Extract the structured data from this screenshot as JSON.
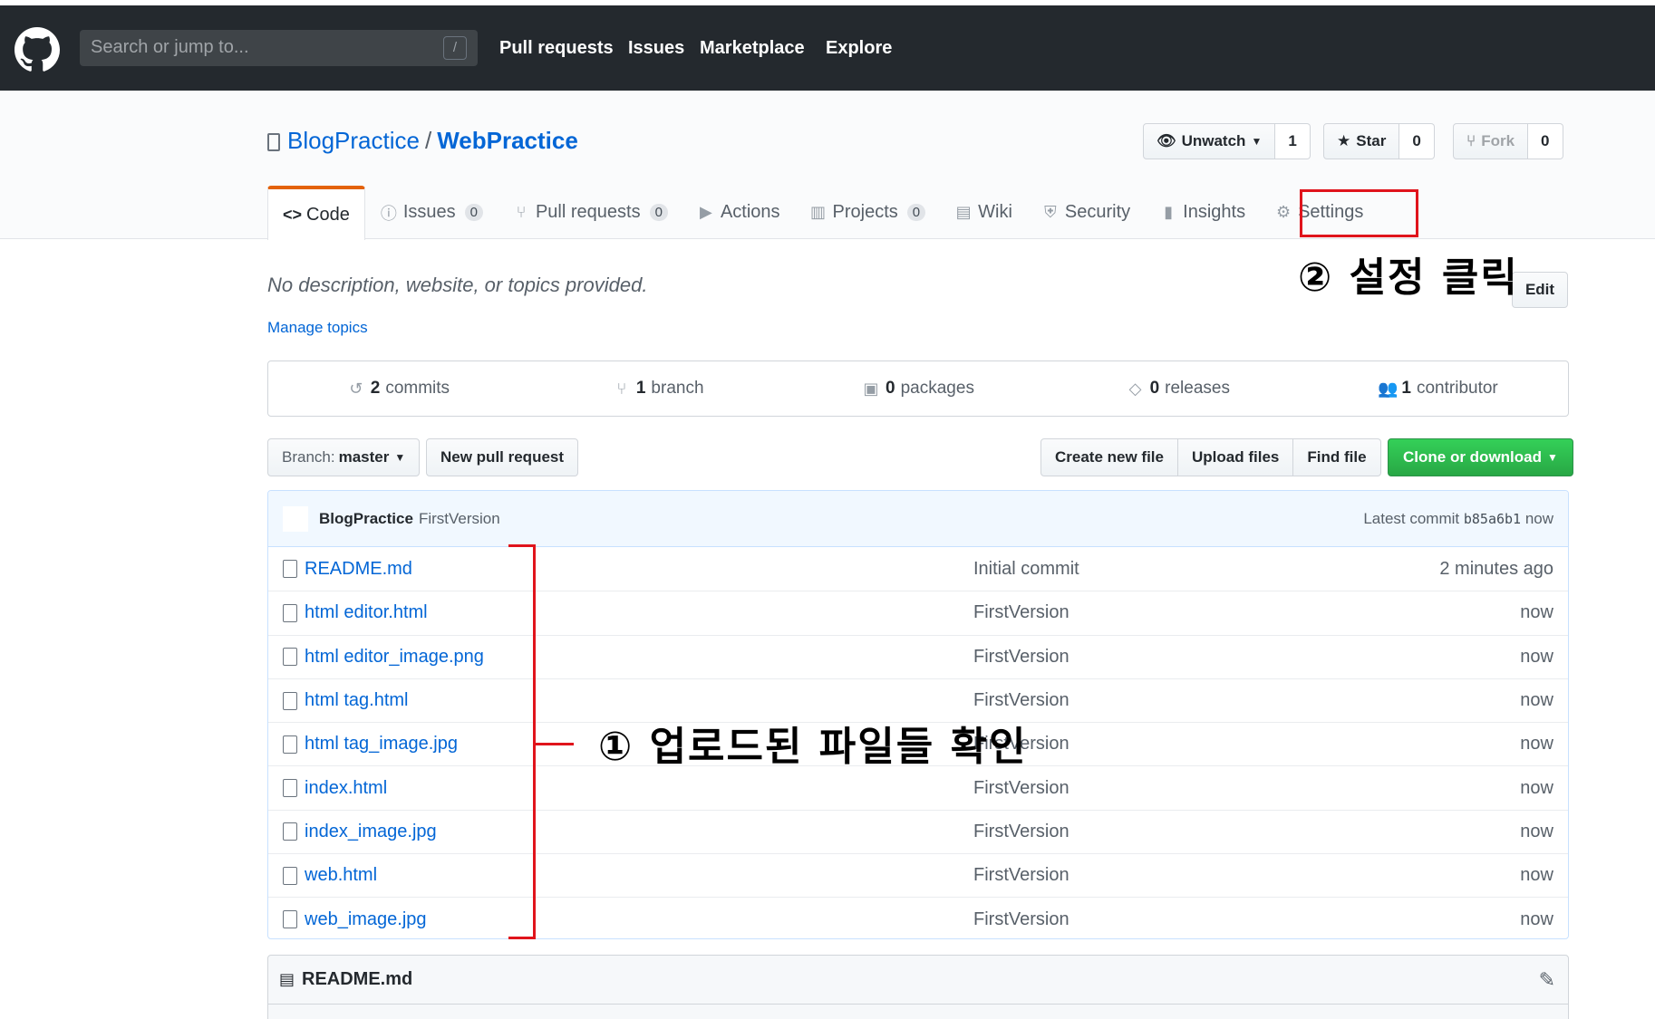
{
  "topbar": {
    "search_placeholder": "Search or jump to...",
    "search_shortcut": "/",
    "nav": [
      "Pull requests",
      "Issues",
      "Marketplace",
      "Explore"
    ]
  },
  "repo": {
    "owner": "BlogPractice",
    "separator": "/",
    "name": "WebPractice",
    "watch_label": "Unwatch",
    "watch_count": "1",
    "star_label": "Star",
    "star_count": "0",
    "fork_label": "Fork",
    "fork_count": "0"
  },
  "tabs": [
    {
      "label": "Code",
      "icon": "<>",
      "counter": ""
    },
    {
      "label": "Issues",
      "icon": "ⓘ",
      "counter": "0"
    },
    {
      "label": "Pull requests",
      "icon": "⑂",
      "counter": "0"
    },
    {
      "label": "Actions",
      "icon": "▶",
      "counter": ""
    },
    {
      "label": "Projects",
      "icon": "▥",
      "counter": "0"
    },
    {
      "label": "Wiki",
      "icon": "▤",
      "counter": ""
    },
    {
      "label": "Security",
      "icon": "⛨",
      "counter": ""
    },
    {
      "label": "Insights",
      "icon": "▮",
      "counter": ""
    },
    {
      "label": "Settings",
      "icon": "⚙",
      "counter": ""
    }
  ],
  "description": "No description, website, or topics provided.",
  "manage_topics": "Manage topics",
  "edit_label": "Edit",
  "annotations": {
    "settings_note": "② 설정 클릭",
    "files_note": "① 업로드된 파일들 확인"
  },
  "summary": {
    "commits": {
      "num": "2",
      "label": "commits"
    },
    "branch": {
      "num": "1",
      "label": "branch"
    },
    "packages": {
      "num": "0",
      "label": "packages"
    },
    "releases": {
      "num": "0",
      "label": "releases"
    },
    "contributor": {
      "num": "1",
      "label": "contributor"
    }
  },
  "actions": {
    "branch_label": "Branch:",
    "branch_value": "master",
    "new_pr": "New pull request",
    "create_file": "Create new file",
    "upload_files": "Upload files",
    "find_file": "Find file",
    "clone": "Clone or download"
  },
  "commit_bar": {
    "author": "BlogPractice",
    "message": "FirstVersion",
    "latest_label": "Latest commit",
    "hash": "b85a6b1",
    "time": "now"
  },
  "files": [
    {
      "name": "README.md",
      "message": "Initial commit",
      "age": "2 minutes ago"
    },
    {
      "name": "html editor.html",
      "message": "FirstVersion",
      "age": "now"
    },
    {
      "name": "html editor_image.png",
      "message": "FirstVersion",
      "age": "now"
    },
    {
      "name": "html tag.html",
      "message": "FirstVersion",
      "age": "now"
    },
    {
      "name": "html tag_image.jpg",
      "message": "FirstVersion",
      "age": "now"
    },
    {
      "name": "index.html",
      "message": "FirstVersion",
      "age": "now"
    },
    {
      "name": "index_image.jpg",
      "message": "FirstVersion",
      "age": "now"
    },
    {
      "name": "web.html",
      "message": "FirstVersion",
      "age": "now"
    },
    {
      "name": "web_image.jpg",
      "message": "FirstVersion",
      "age": "now"
    }
  ],
  "readme": {
    "title": "README.md"
  },
  "colors": {
    "accent": "#0366d6",
    "annotation": "#e0141c",
    "topbar": "#24292e",
    "green": "#28a745"
  }
}
